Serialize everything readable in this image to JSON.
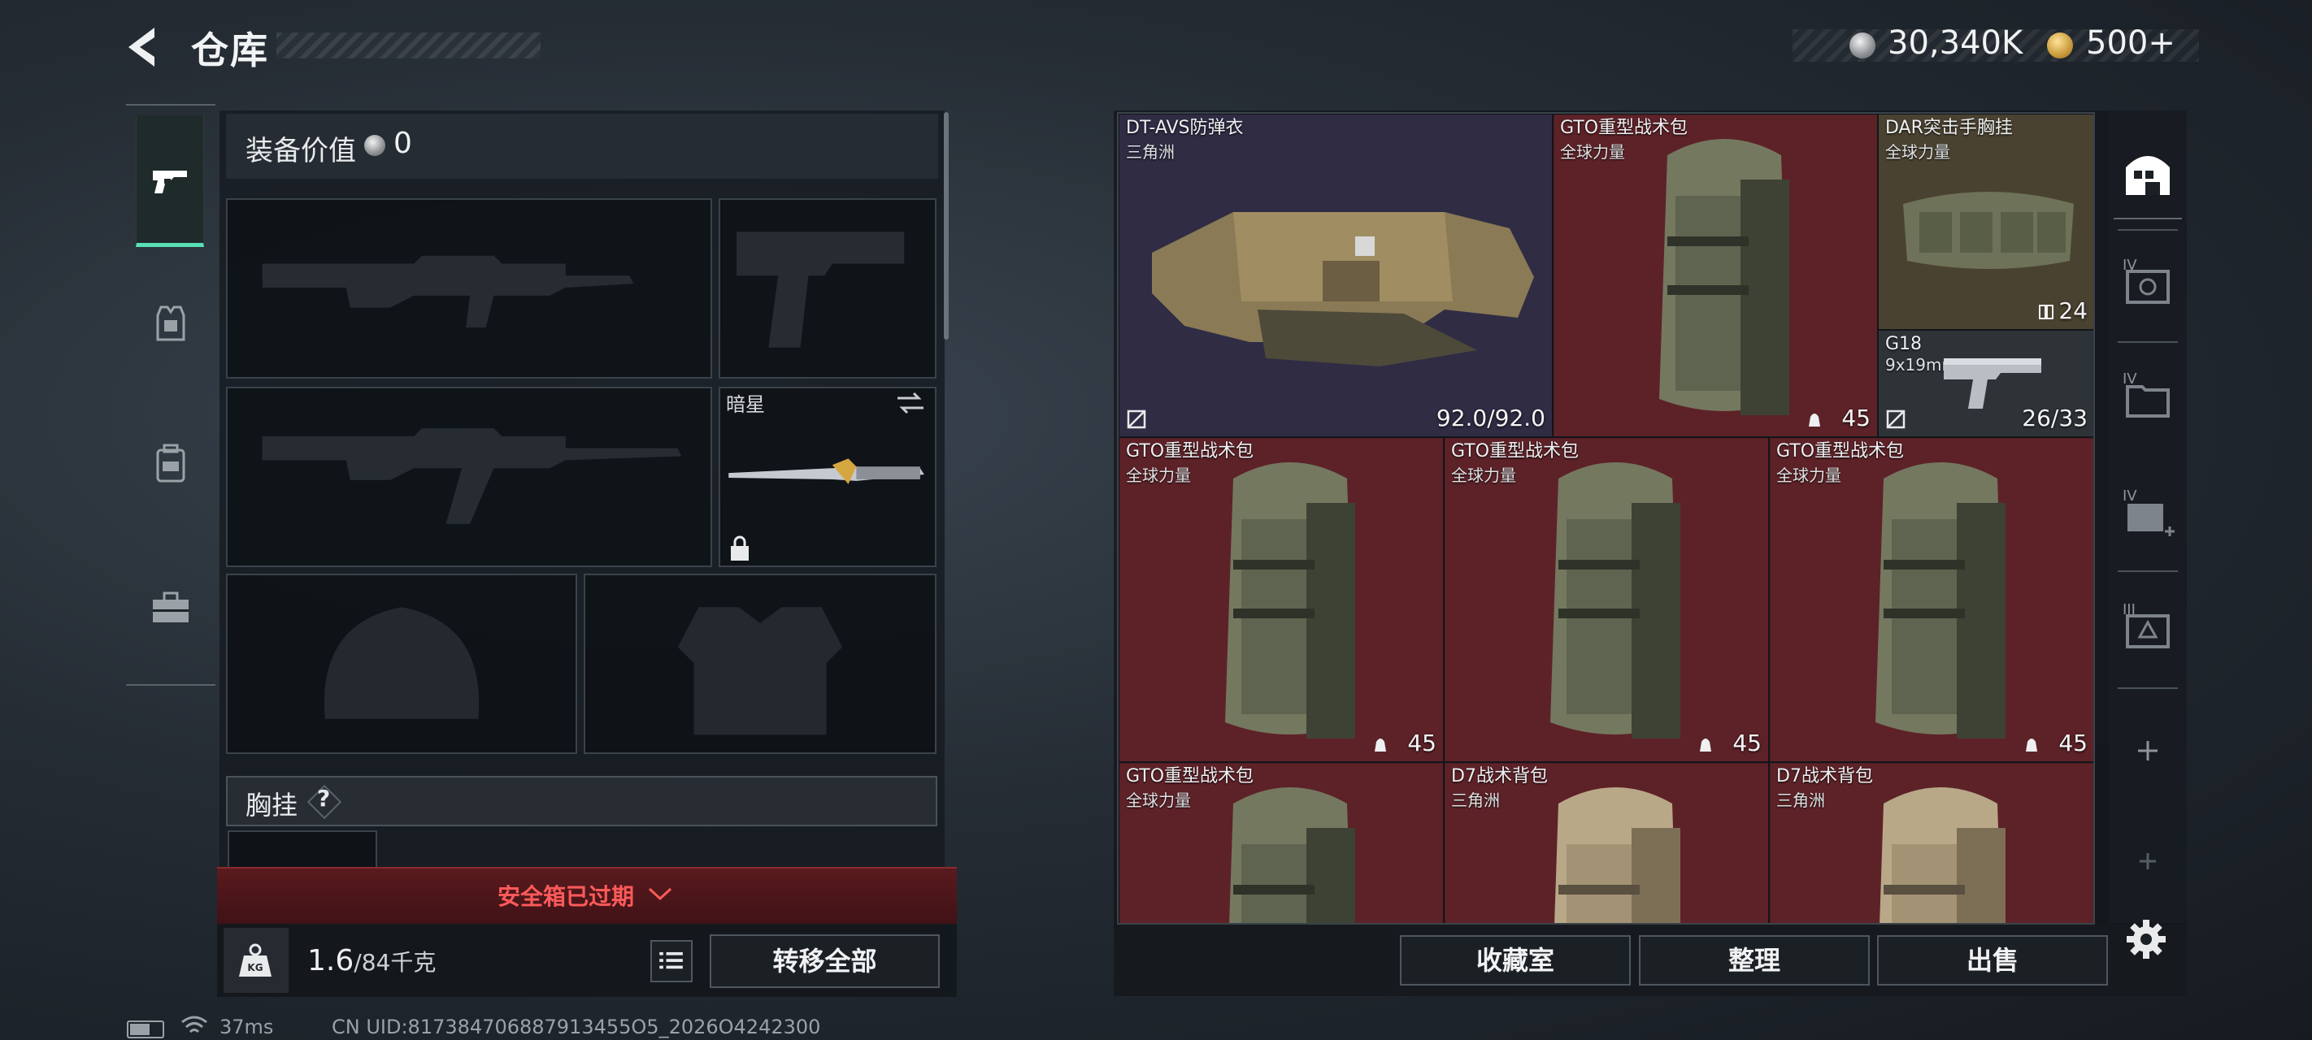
{
  "header": {
    "title": "仓库",
    "currency_silver": "30,340K",
    "currency_gold": "500+"
  },
  "tabs": [
    {
      "icon": "pistol-icon",
      "active": true
    },
    {
      "icon": "armor-icon"
    },
    {
      "icon": "backpack-icon"
    },
    {
      "icon": "toolbox-icon"
    }
  ],
  "equipment": {
    "value_label": "装备价值",
    "value": "0",
    "melee_name": "暗星",
    "chest_label": "胸挂",
    "chest_help": "?",
    "safebox_expired": "安全箱已过期",
    "weight_current": "1.6",
    "weight_max": "/84千克",
    "transfer_all": "转移全部"
  },
  "storage": {
    "items": [
      {
        "name": "DT-AVS防弹衣",
        "sub": "三角洲",
        "meta": "92.0/92.0",
        "color": "purple"
      },
      {
        "name": "GTO重型战术包",
        "sub": "全球力量",
        "meta": "45",
        "color": "red"
      },
      {
        "name": "DAR突击手胸挂",
        "sub": "全球力量",
        "meta": "24",
        "color": "gold"
      },
      {
        "name": "G18",
        "sub": "9x19mm",
        "meta": "26/33",
        "color": "gray"
      },
      {
        "name": "GTO重型战术包",
        "sub": "全球力量",
        "meta": "45",
        "color": "red"
      },
      {
        "name": "GTO重型战术包",
        "sub": "全球力量",
        "meta": "45",
        "color": "red"
      },
      {
        "name": "GTO重型战术包",
        "sub": "全球力量",
        "meta": "45",
        "color": "red"
      },
      {
        "name": "GTO重型战术包",
        "sub": "全球力量",
        "meta": "",
        "color": "red"
      },
      {
        "name": "D7战术背包",
        "sub": "三角洲",
        "meta": "",
        "color": "red"
      },
      {
        "name": "D7战术背包",
        "sub": "三角洲",
        "meta": "",
        "color": "red"
      }
    ]
  },
  "side_icons": [
    "storage-home-icon",
    "safebox-iv-icon",
    "case-iv-icon",
    "case-iv-plus-icon",
    "case-iii-icon"
  ],
  "side_labels": [
    "IV",
    "IV",
    "IV",
    "III"
  ],
  "actions": {
    "collection_room": "收藏室",
    "organize": "整理",
    "sell": "出售"
  },
  "status": {
    "ping": "37ms",
    "uid": "CN UID:817384706887913455O5_2026O4242300"
  },
  "colors": {
    "accent": "#59e0b5",
    "item_red": "#5d2228",
    "item_purple": "#2f2c44",
    "item_gold": "#4a4230",
    "warning": "#ff5a5a"
  }
}
